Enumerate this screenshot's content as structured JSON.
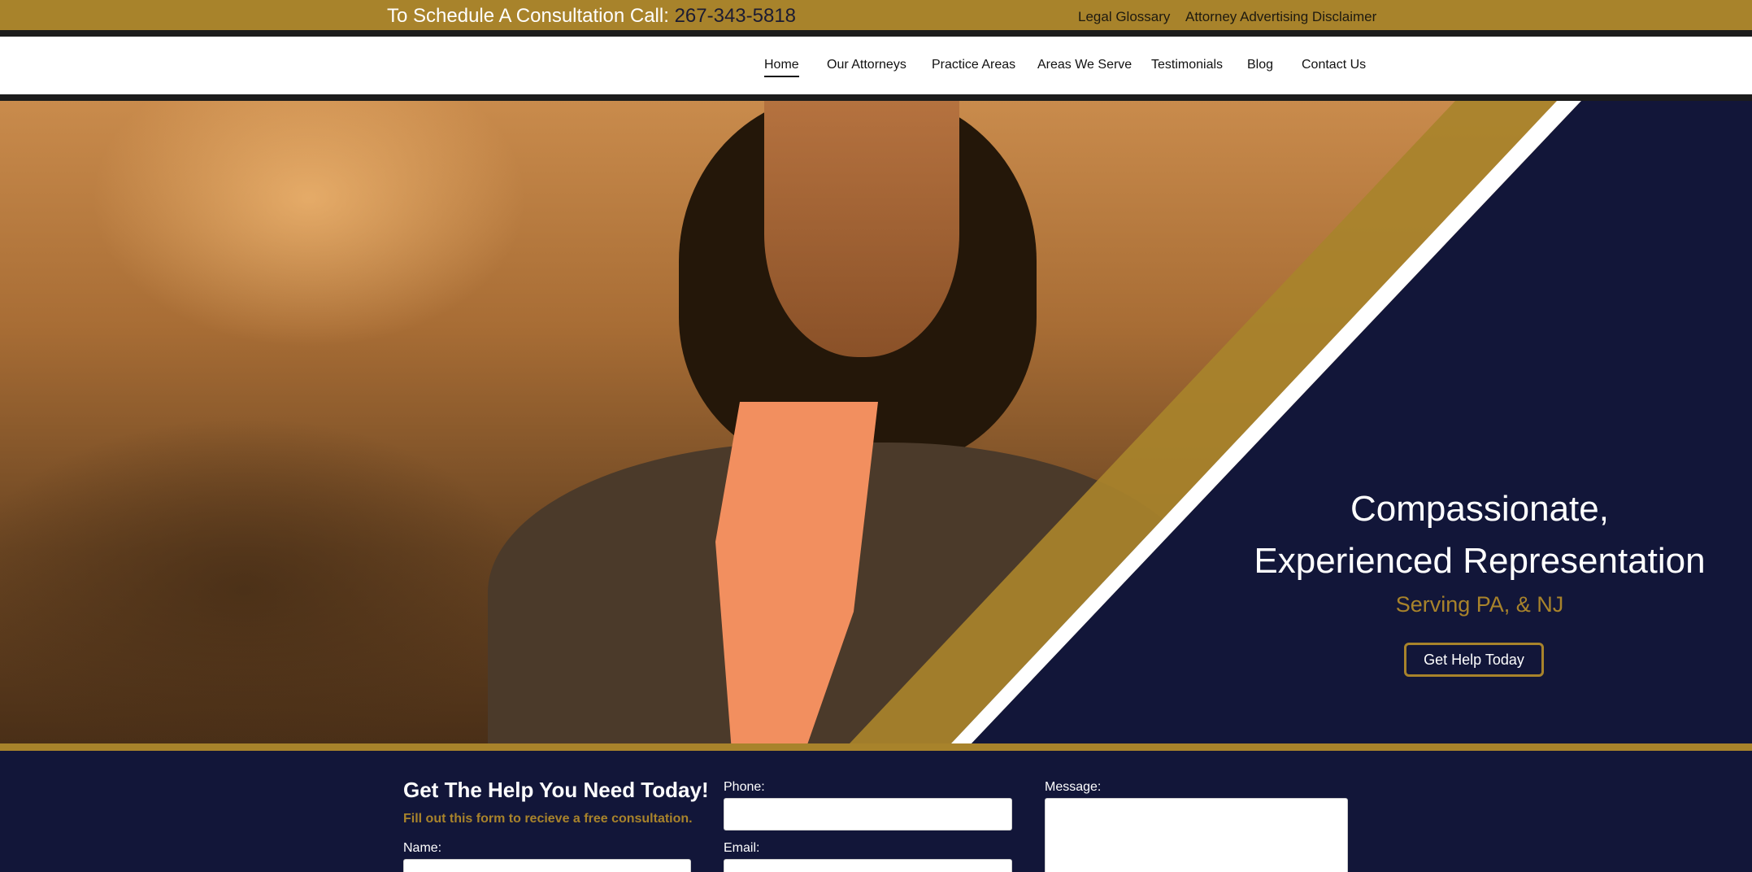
{
  "colors": {
    "gold": "#a8832b",
    "navy": "#121639",
    "dark_strip": "#1c1c1c",
    "white": "#ffffff"
  },
  "topbar": {
    "cta_text": "To Schedule A Consultation Call:",
    "phone": "267-343-5818",
    "links": [
      "Legal Glossary",
      "Attorney Advertising Disclaimer"
    ]
  },
  "nav": {
    "items": [
      "Home",
      "Our Attorneys",
      "Practice Areas",
      "Areas We Serve",
      "Testimonials",
      "Blog",
      "Contact Us"
    ],
    "active": "Home"
  },
  "hero": {
    "heading_line1": "Compassionate,",
    "heading_line2": "Experienced Representation",
    "subheading": "Serving PA, & NJ",
    "button_label": "Get Help Today",
    "image_description_icon": "attorney-portrait-image"
  },
  "form": {
    "title": "Get The Help You Need Today!",
    "subtitle": "Fill out this form to recieve a free consultation.",
    "fields": {
      "name_label": "Name:",
      "phone_label": "Phone:",
      "email_label": "Email:",
      "message_label": "Message:"
    },
    "values": {
      "name": "",
      "phone": "",
      "email": "",
      "message": ""
    }
  }
}
